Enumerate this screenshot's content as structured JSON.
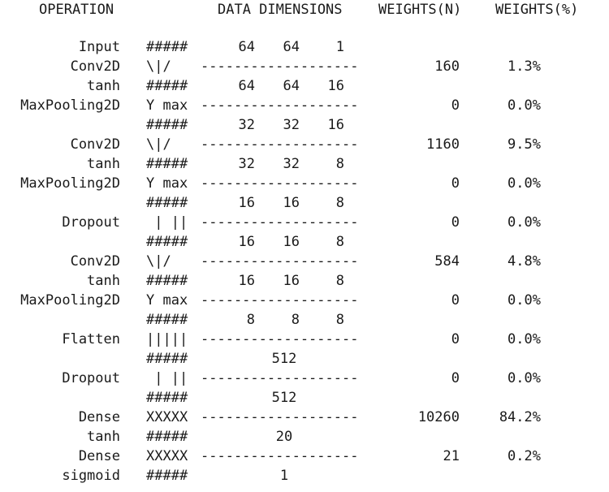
{
  "header": {
    "operation": "OPERATION",
    "dimensions": "DATA DIMENSIONS",
    "weights_n": "WEIGHTS(N)",
    "weights_pct": "WEIGHTS(%)"
  },
  "rows": [
    {
      "op": "Input",
      "sym": "#####",
      "dims": [
        "64",
        "64",
        "1"
      ]
    },
    {
      "op": "Conv2D",
      "sym": "\\|/",
      "dashes": "-------------------",
      "wn": "160",
      "wp": "1.3%"
    },
    {
      "op": "tanh",
      "sym": "#####",
      "dims": [
        "64",
        "64",
        "16"
      ]
    },
    {
      "op": "MaxPooling2D",
      "sym": "Y max",
      "dashes": "-------------------",
      "wn": "0",
      "wp": "0.0%"
    },
    {
      "sym": "#####",
      "dims": [
        "32",
        "32",
        "16"
      ]
    },
    {
      "op": "Conv2D",
      "sym": "\\|/",
      "dashes": "-------------------",
      "wn": "1160",
      "wp": "9.5%"
    },
    {
      "op": "tanh",
      "sym": "#####",
      "dims": [
        "32",
        "32",
        "8"
      ]
    },
    {
      "op": "MaxPooling2D",
      "sym": "Y max",
      "dashes": "-------------------",
      "wn": "0",
      "wp": "0.0%"
    },
    {
      "sym": "#####",
      "dims": [
        "16",
        "16",
        "8"
      ]
    },
    {
      "op": "Dropout",
      "sym": " | ||",
      "dashes": "-------------------",
      "wn": "0",
      "wp": "0.0%"
    },
    {
      "sym": "#####",
      "dims": [
        "16",
        "16",
        "8"
      ]
    },
    {
      "op": "Conv2D",
      "sym": "\\|/",
      "dashes": "-------------------",
      "wn": "584",
      "wp": "4.8%"
    },
    {
      "op": "tanh",
      "sym": "#####",
      "dims": [
        "16",
        "16",
        "8"
      ]
    },
    {
      "op": "MaxPooling2D",
      "sym": "Y max",
      "dashes": "-------------------",
      "wn": "0",
      "wp": "0.0%"
    },
    {
      "sym": "#####",
      "dims": [
        "8",
        "8",
        "8"
      ]
    },
    {
      "op": "Flatten",
      "sym": "|||||",
      "dashes": "-------------------",
      "wn": "0",
      "wp": "0.0%"
    },
    {
      "sym": "#####",
      "flat": "512"
    },
    {
      "op": "Dropout",
      "sym": " | ||",
      "dashes": "-------------------",
      "wn": "0",
      "wp": "0.0%"
    },
    {
      "sym": "#####",
      "flat": "512"
    },
    {
      "op": "Dense",
      "sym": "XXXXX",
      "dashes": "-------------------",
      "wn": "10260",
      "wp": "84.2%"
    },
    {
      "op": "tanh",
      "sym": "#####",
      "flat": "20"
    },
    {
      "op": "Dense",
      "sym": "XXXXX",
      "dashes": "-------------------",
      "wn": "21",
      "wp": "0.2%"
    },
    {
      "op": "sigmoid",
      "sym": "#####",
      "flat": "1"
    }
  ]
}
